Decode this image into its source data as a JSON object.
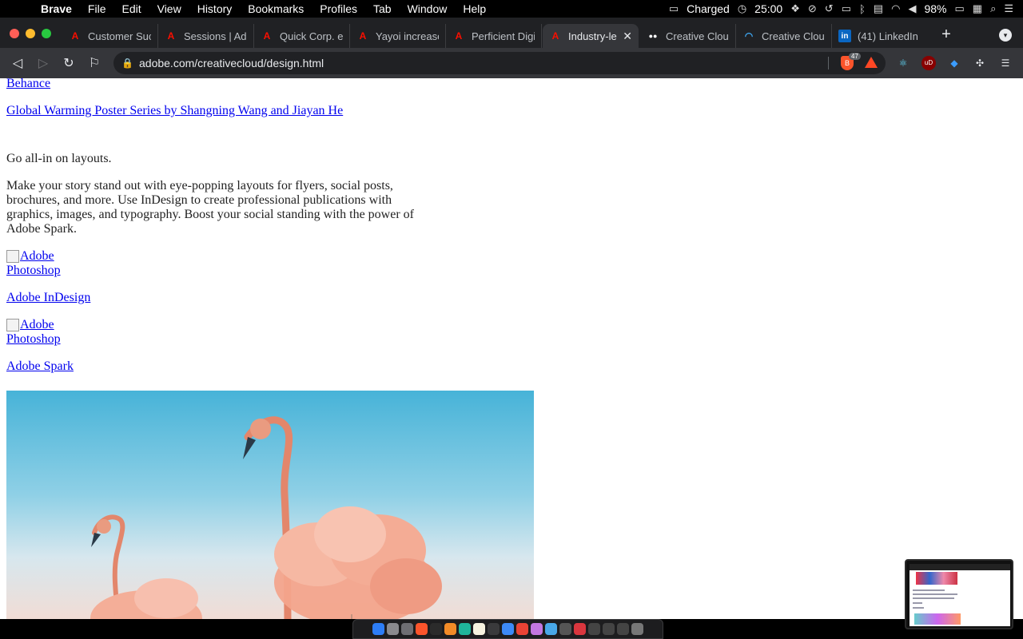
{
  "menubar": {
    "app_name": "Brave",
    "items": [
      "File",
      "Edit",
      "View",
      "History",
      "Bookmarks",
      "Profiles",
      "Tab",
      "Window",
      "Help"
    ],
    "battery_status": "Charged",
    "timer": "25:00",
    "battery_percent": "98%"
  },
  "browser": {
    "tabs": [
      {
        "title": "Customer Succ",
        "icon": "adobe-icon"
      },
      {
        "title": "Sessions | Ado",
        "icon": "adobe-icon"
      },
      {
        "title": "Quick Corp. en",
        "icon": "adobe-icon"
      },
      {
        "title": "Yayoi increase",
        "icon": "adobe-icon"
      },
      {
        "title": "Perficient Digit",
        "icon": "adobe-icon"
      },
      {
        "title": "Industry-le",
        "icon": "adobe-icon",
        "active": true
      },
      {
        "title": "Creative Cloud",
        "icon": "medium-icon"
      },
      {
        "title": "Creative Cloud",
        "icon": "wave-icon"
      },
      {
        "title": "(41) LinkedIn",
        "icon": "linkedin-icon"
      }
    ],
    "url": "adobe.com/creativecloud/design.html",
    "shield_count": "47"
  },
  "page": {
    "behance_link": "Behance",
    "poster_link": "Global Warming Poster Series by Shangning Wang and Jiayan He",
    "heading": "Go all-in on layouts.",
    "body": "Make your story stand out with eye-popping layouts for flyers, social posts, brochures, and more. Use InDesign to create professional publications with graphics, images, and typography. Boost your social standing with the power of Adobe Spark.",
    "img1_alt": "Adobe Photoshop",
    "link_indesign": "Adobe InDesign",
    "img2_alt": "Adobe Photoshop",
    "link_spark": "Adobe Spark"
  },
  "colors": {
    "link": "#0000ee",
    "adobe_red": "#fa0f00",
    "chrome_dark": "#202124",
    "toolbar": "#35363a"
  }
}
